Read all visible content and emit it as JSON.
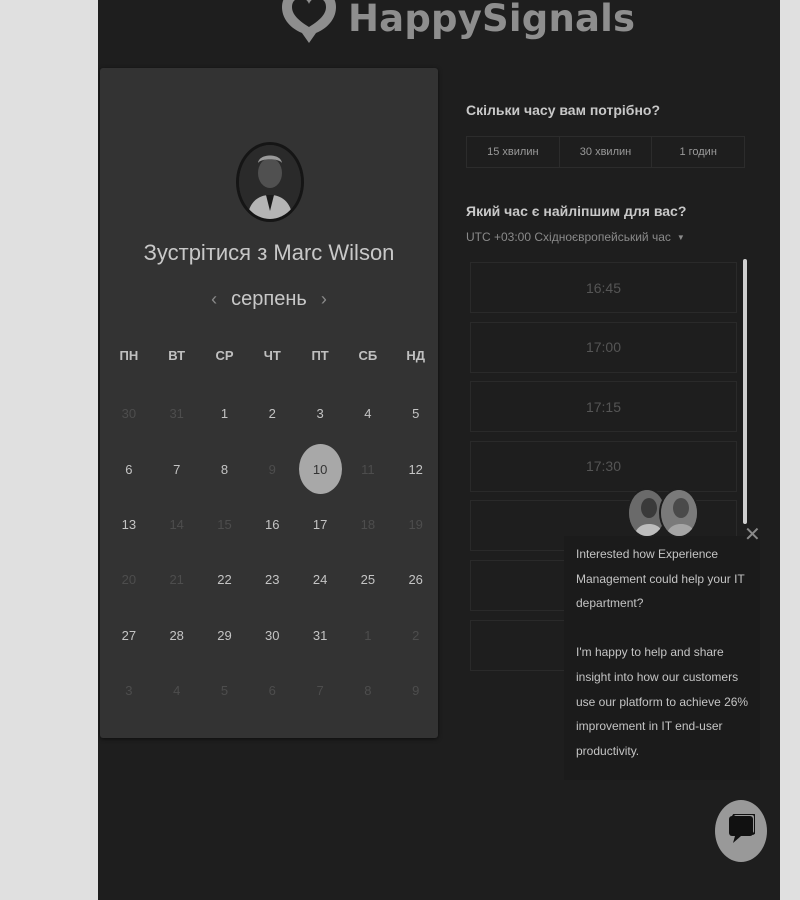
{
  "brand": {
    "name": "HappySignals"
  },
  "calendar": {
    "title": "Зустрітися з Marc Wilson",
    "month": "серпень",
    "prev_icon": "chevron-left-icon",
    "next_icon": "chevron-right-icon",
    "weekdays": [
      "ПН",
      "ВТ",
      "СР",
      "ЧТ",
      "ПТ",
      "СБ",
      "НД"
    ],
    "weeks": [
      [
        {
          "d": "30",
          "s": "muted"
        },
        {
          "d": "31",
          "s": "muted"
        },
        {
          "d": "1",
          "s": "available"
        },
        {
          "d": "2",
          "s": "available"
        },
        {
          "d": "3",
          "s": "available"
        },
        {
          "d": "4",
          "s": "available"
        },
        {
          "d": "5",
          "s": "available"
        }
      ],
      [
        {
          "d": "6",
          "s": "available"
        },
        {
          "d": "7",
          "s": "available"
        },
        {
          "d": "8",
          "s": "available"
        },
        {
          "d": "9",
          "s": "muted"
        },
        {
          "d": "10",
          "s": "selected"
        },
        {
          "d": "11",
          "s": "muted"
        },
        {
          "d": "12",
          "s": "available"
        }
      ],
      [
        {
          "d": "13",
          "s": "available"
        },
        {
          "d": "14",
          "s": "muted"
        },
        {
          "d": "15",
          "s": "muted"
        },
        {
          "d": "16",
          "s": "available"
        },
        {
          "d": "17",
          "s": "available"
        },
        {
          "d": "18",
          "s": "muted"
        },
        {
          "d": "19",
          "s": "muted"
        }
      ],
      [
        {
          "d": "20",
          "s": "muted"
        },
        {
          "d": "21",
          "s": "muted"
        },
        {
          "d": "22",
          "s": "available"
        },
        {
          "d": "23",
          "s": "available"
        },
        {
          "d": "24",
          "s": "available"
        },
        {
          "d": "25",
          "s": "available"
        },
        {
          "d": "26",
          "s": "available"
        }
      ],
      [
        {
          "d": "27",
          "s": "available"
        },
        {
          "d": "28",
          "s": "available"
        },
        {
          "d": "29",
          "s": "available"
        },
        {
          "d": "30",
          "s": "available"
        },
        {
          "d": "31",
          "s": "available"
        },
        {
          "d": "1",
          "s": "muted"
        },
        {
          "d": "2",
          "s": "muted"
        }
      ],
      [
        {
          "d": "3",
          "s": "muted"
        },
        {
          "d": "4",
          "s": "muted"
        },
        {
          "d": "5",
          "s": "muted"
        },
        {
          "d": "6",
          "s": "muted"
        },
        {
          "d": "7",
          "s": "muted"
        },
        {
          "d": "8",
          "s": "muted"
        },
        {
          "d": "9",
          "s": "muted"
        }
      ]
    ]
  },
  "duration": {
    "title": "Скільки часу вам потрібно?",
    "options": [
      "15 хвилин",
      "30 хвилин",
      "1 годин"
    ]
  },
  "time": {
    "title": "Який час є найліпшим для вас?",
    "timezone": "UTC +03:00 Східноєвропейський час",
    "slots": [
      "16:45",
      "17:00",
      "17:15",
      "17:30",
      "",
      "",
      ""
    ]
  },
  "chat": {
    "close_icon": "close-icon",
    "messages": [
      "Interested how Experience Management could help your IT department?",
      "I'm happy to help and share insight into how our customers use our platform to achieve 26% improvement in IT end-user productivity."
    ],
    "launcher_icon": "chat-bubble-icon"
  },
  "colors": {
    "page_bg": "#1e1e1e",
    "panel_bg": "#333333",
    "selected_day": "#a8a8a8",
    "logo": "#8e8e8e"
  }
}
